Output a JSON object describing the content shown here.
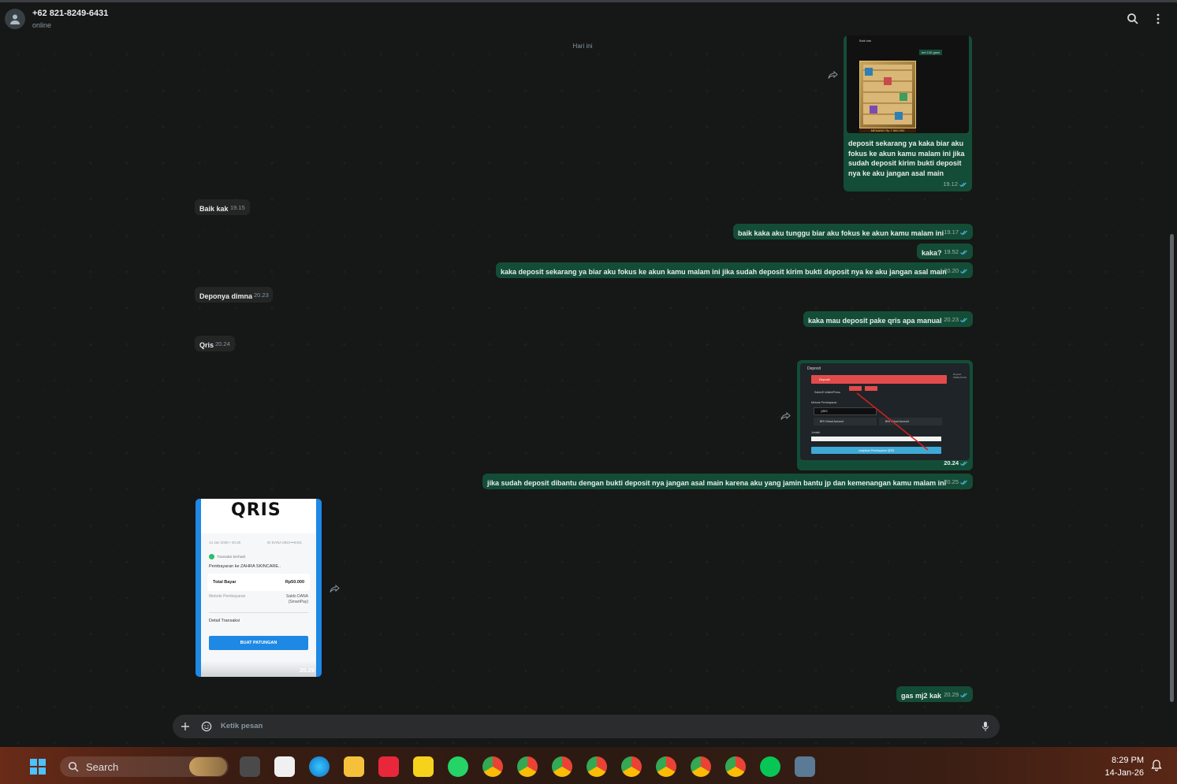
{
  "header": {
    "contact_name": "+62 821-8249-6431",
    "status": "online"
  },
  "day_separator": "Hari ini",
  "messages": [
    {
      "dir": "out",
      "text_lines": [
        "deposit sekarang ya kaka biar aku",
        "fokus ke akun kamu malam ini jika",
        "sudah deposit kirim bukti deposit",
        "nya ke aku jangan asal main"
      ],
      "time": "19.12"
    },
    {
      "dir": "in",
      "text": "Baik kak",
      "time": "19.15"
    },
    {
      "dir": "out",
      "text": "baik kaka aku tunggu biar aku fokus ke akun kamu malam ini",
      "time": "19.17"
    },
    {
      "dir": "out",
      "text": "kaka?",
      "time": "19.52"
    },
    {
      "dir": "out",
      "text": "kaka deposit sekarang ya biar aku fokus ke akun kamu malam ini jika sudah deposit kirim bukti deposit nya ke aku jangan asal main",
      "time": "20.20"
    },
    {
      "dir": "in",
      "text": "Deponya dimna",
      "time": "20.23"
    },
    {
      "dir": "out",
      "text": "kaka mau deposit pake qris apa manual",
      "time": "20.23"
    },
    {
      "dir": "in",
      "text": "Qris",
      "time": "20.24"
    },
    {
      "dir": "out",
      "image": "deposit-screenshot",
      "time": "20.24"
    },
    {
      "dir": "out",
      "text": "jika sudah deposit dibantu dengan bukti deposit nya jangan asal main karena aku yang jamin bantu jp dan kemenangan kamu malam ini",
      "time": "20.25"
    },
    {
      "dir": "in",
      "image": "qris-receipt",
      "time": "20.29"
    },
    {
      "dir": "out",
      "text": "gas mj2 kak",
      "time": "20.29"
    }
  ],
  "deposit_image": {
    "title": "Deposit",
    "tab_label": "Deposit",
    "method_label": "Metode Pembayaran",
    "option_qris": "QRIS",
    "option_bri": "BRI Virtual Account",
    "option_bni": "BNI Virtual Account",
    "amount_label": "Jumlah",
    "submit_label": "Lanjutkan Pembayaran QRIS",
    "row_label": "Saldo/E-Wallet/Pulsa",
    "side_note": "Deposit PERHATIAN"
  },
  "qris_image": {
    "logo": "QRIS",
    "date": "14 Jan 2026 • 20:28",
    "account": "ID DANA 0821•••6431",
    "status": "Transaksi berhasil",
    "merchant": "Pembayaran ke ZAHRA SKINCARE..",
    "total_label": "Total Bayar",
    "total_value": "Rp50.000",
    "method_label": "Metode Pembayaran",
    "method_value_1": "Saldo DANA",
    "method_value_2": "(SmartPay)",
    "detail_label": "Detail Transaksi",
    "button_label": "BUAT PATUNGAN"
  },
  "slot_image": {
    "caption_top": "Baik kak",
    "caption_right": "bet 100 gans",
    "win_text": "MENANG Rp 7.560.000"
  },
  "input": {
    "placeholder": "Ketik pesan"
  },
  "taskbar": {
    "search_label": "Search",
    "time": "8:29 PM",
    "date": "14-Jan-26"
  },
  "colors": {
    "outgoing_bubble": "#144d37",
    "incoming_bubble": "#242626",
    "background": "#161717",
    "read_tick": "#53bdeb"
  }
}
